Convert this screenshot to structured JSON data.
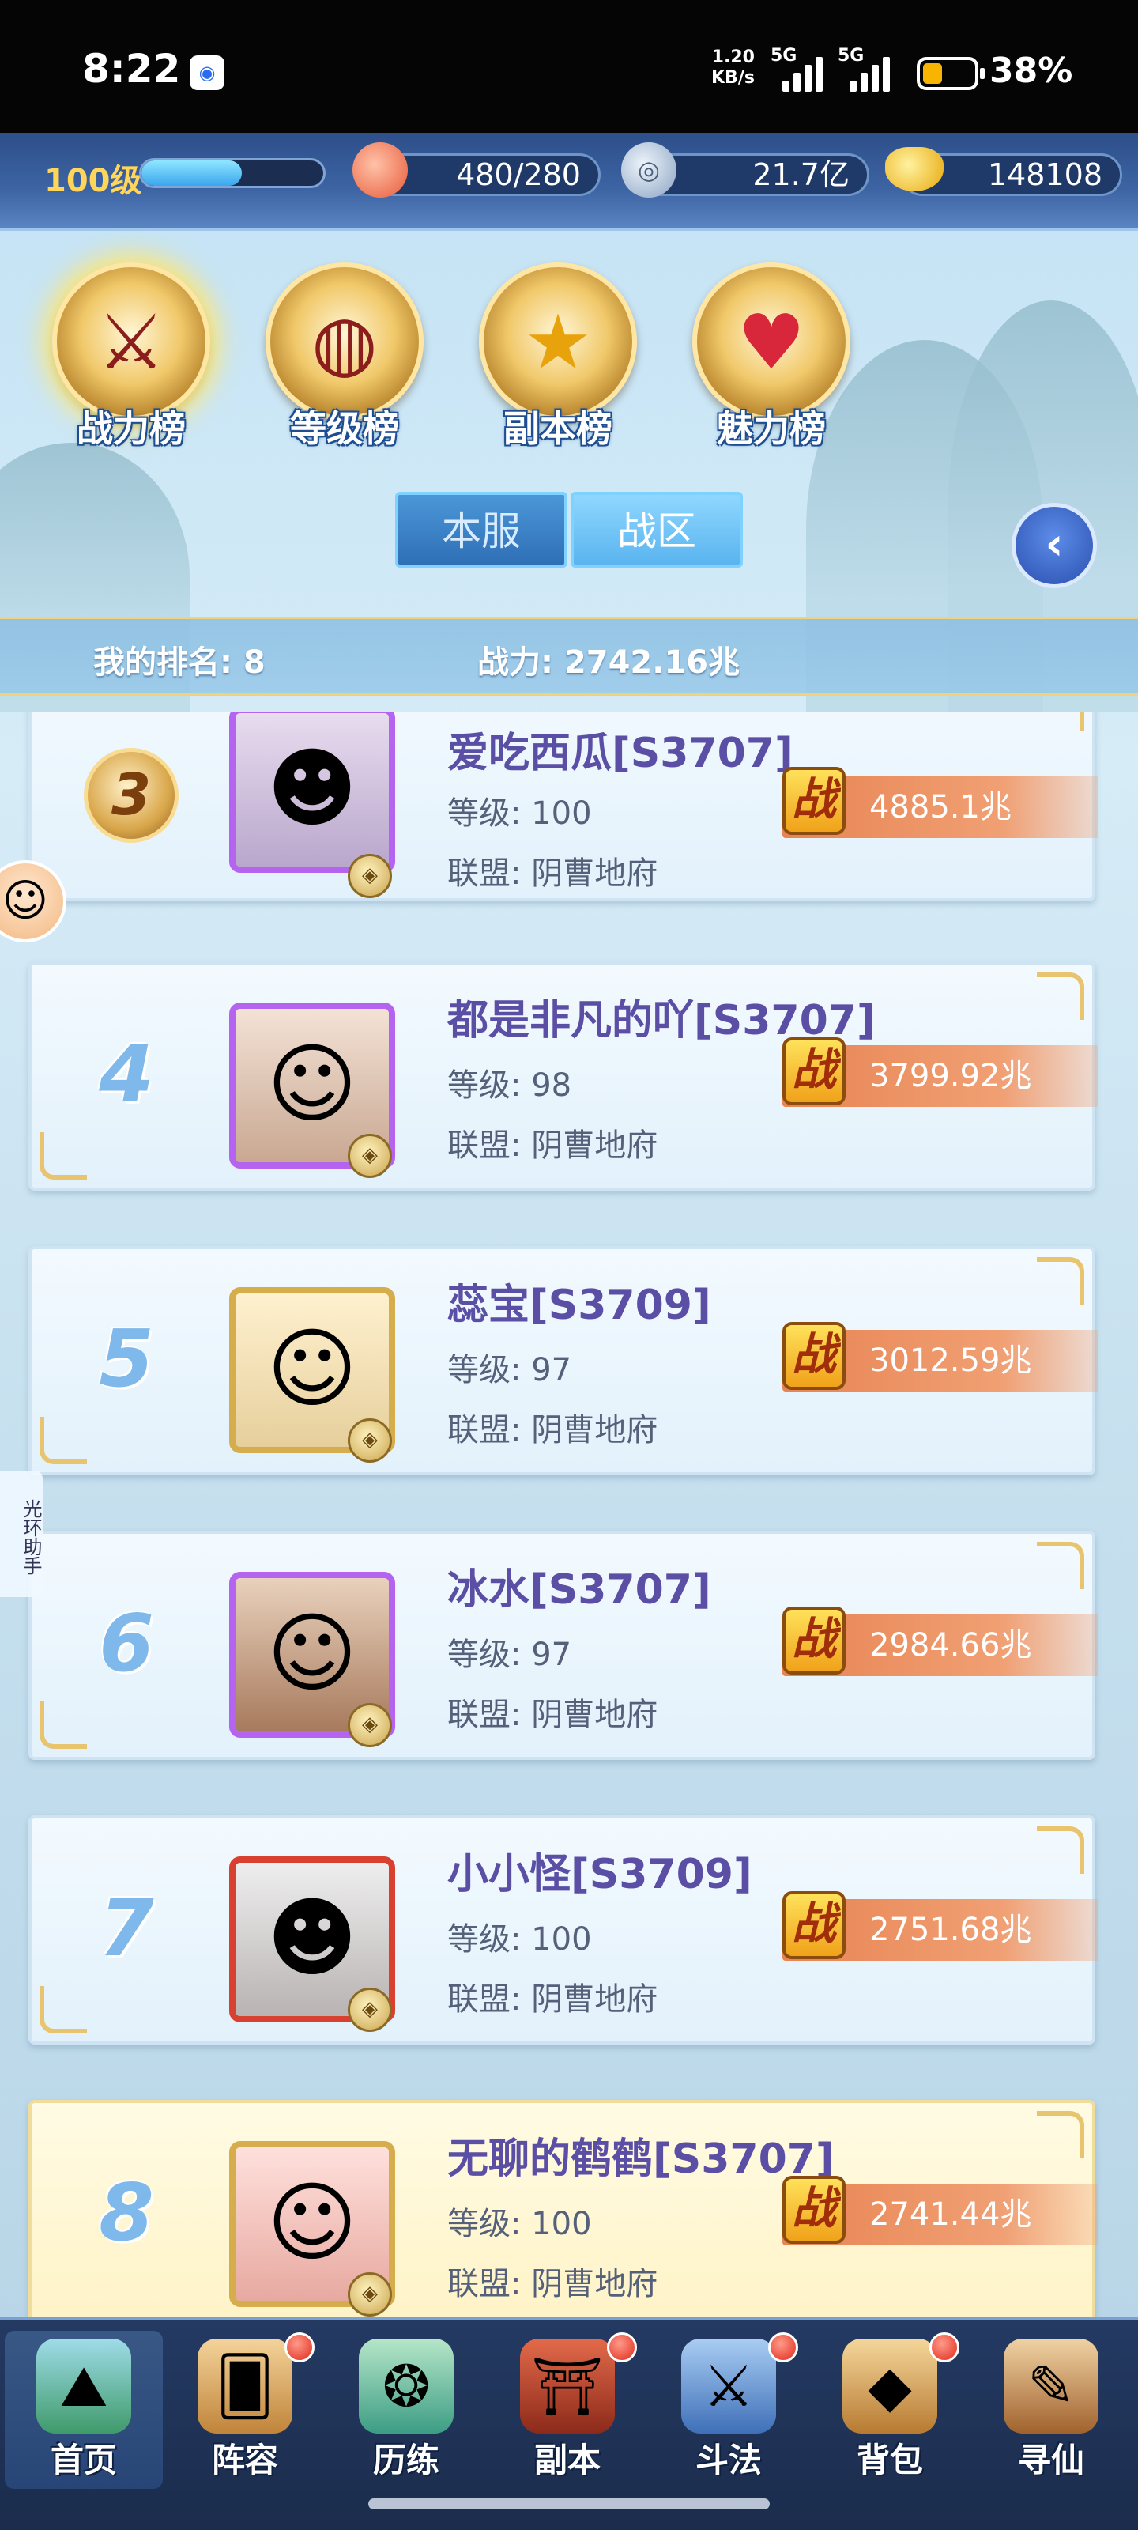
{
  "status_bar": {
    "time": "8:22",
    "net_speed_value": "1.20",
    "net_speed_unit": "KB/s",
    "network_1": "5G",
    "network_2": "5G",
    "battery": "38%",
    "battery_level": 0.38
  },
  "resources": {
    "level_label": "100级",
    "level_progress": 0.55,
    "stamina": "480/280",
    "silver": "21.7亿",
    "gold": "148108"
  },
  "categories": [
    {
      "label": "战力榜",
      "icon": "sword-emblem-icon",
      "active": true
    },
    {
      "label": "等级榜",
      "icon": "drum-emblem-icon",
      "active": false
    },
    {
      "label": "副本榜",
      "icon": "star-emblem-icon",
      "active": false
    },
    {
      "label": "魅力榜",
      "icon": "heart-emblem-icon",
      "active": false
    }
  ],
  "server_tabs": {
    "local": "本服",
    "region": "战区"
  },
  "my_rank": {
    "rank_text": "我的排名: 8",
    "power_text": "战力: 2742.16兆"
  },
  "power_badge": "战",
  "leaderboard": [
    {
      "rank": "3",
      "name": "爱吃西瓜[S3707]",
      "level": "等级: 100",
      "guild": "联盟: 阴曹地府",
      "power": "4885.1兆",
      "frame": "purple"
    },
    {
      "rank": "4",
      "name": "都是非凡的吖[S3707]",
      "level": "等级: 98",
      "guild": "联盟: 阴曹地府",
      "power": "3799.92兆",
      "frame": "purple"
    },
    {
      "rank": "5",
      "name": "蕊宝[S3709]",
      "level": "等级: 97",
      "guild": "联盟: 阴曹地府",
      "power": "3012.59兆",
      "frame": "gold"
    },
    {
      "rank": "6",
      "name": "冰水[S3707]",
      "level": "等级: 97",
      "guild": "联盟: 阴曹地府",
      "power": "2984.66兆",
      "frame": "purple"
    },
    {
      "rank": "7",
      "name": "小小怪[S3709]",
      "level": "等级: 100",
      "guild": "联盟: 阴曹地府",
      "power": "2751.68兆",
      "frame": "red"
    },
    {
      "rank": "8",
      "name": "无聊的鹤鹤[S3707]",
      "level": "等级: 100",
      "guild": "联盟: 阴曹地府",
      "power": "2741.44兆",
      "frame": "gold"
    }
  ],
  "side_helper": "光环助手",
  "bottom_nav": [
    {
      "label": "首页",
      "icon": "home-island-icon",
      "badge": false
    },
    {
      "label": "阵容",
      "icon": "cards-icon",
      "badge": true
    },
    {
      "label": "历练",
      "icon": "dragon-icon",
      "badge": false
    },
    {
      "label": "副本",
      "icon": "gate-icon",
      "badge": true
    },
    {
      "label": "斗法",
      "icon": "swords-icon",
      "badge": true
    },
    {
      "label": "背包",
      "icon": "bag-icon",
      "badge": true
    },
    {
      "label": "寻仙",
      "icon": "scroll-icon",
      "badge": false
    }
  ]
}
